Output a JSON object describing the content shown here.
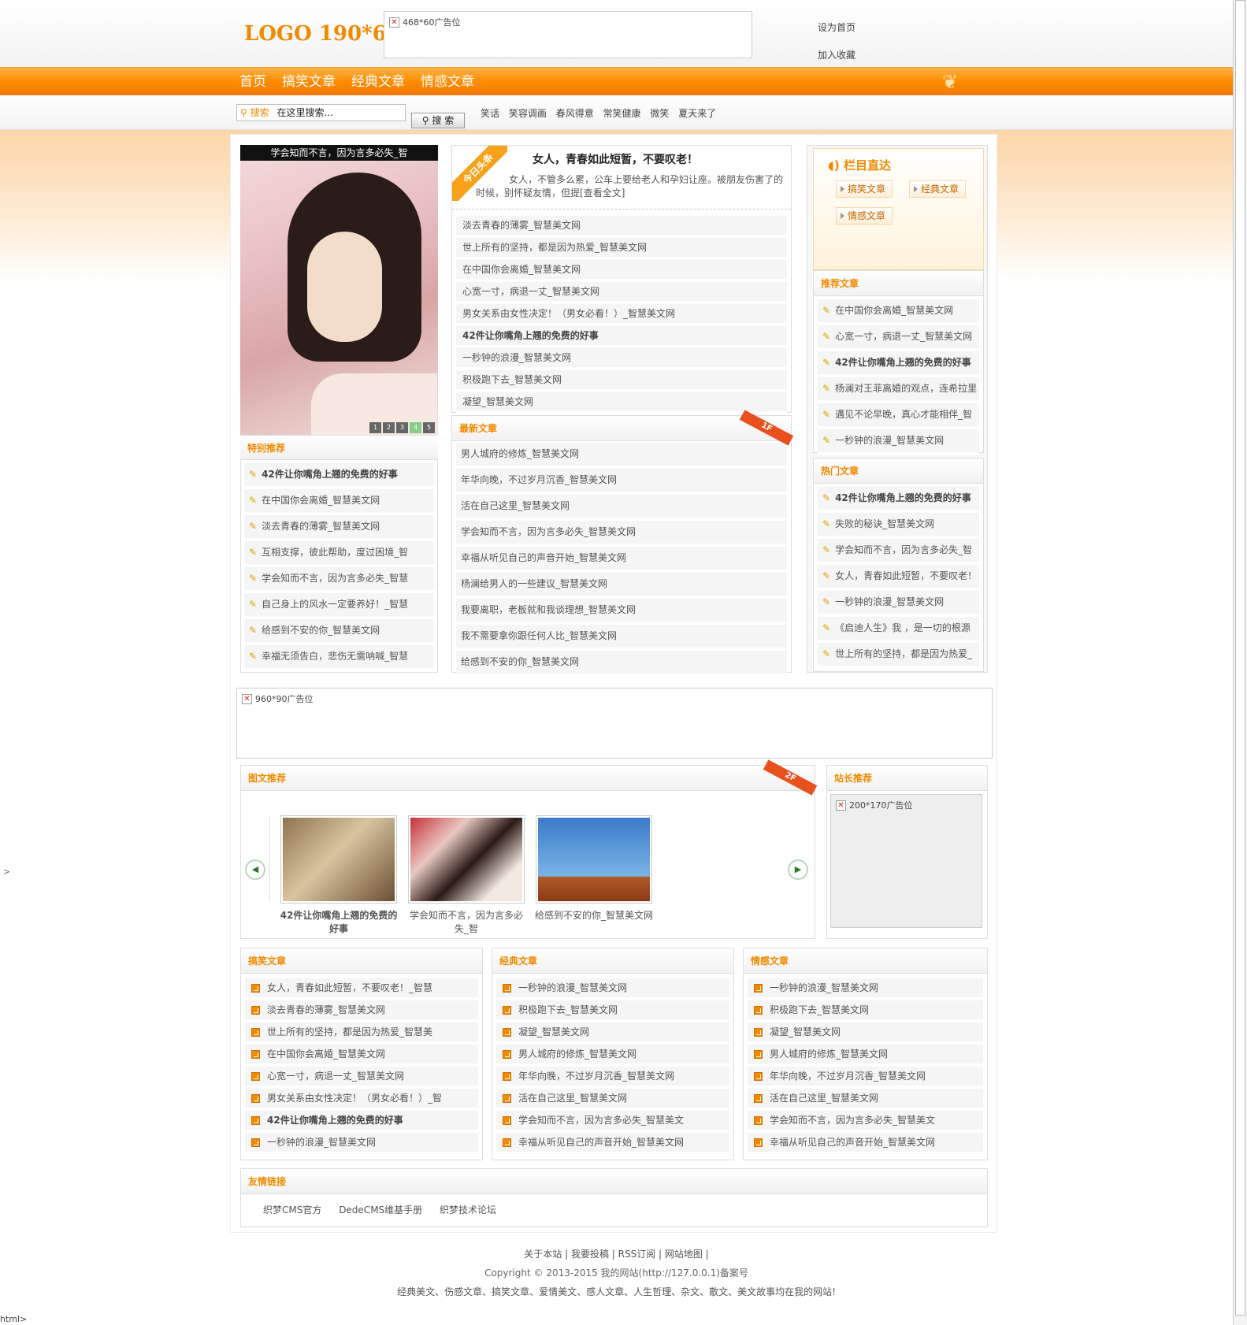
{
  "header": {
    "logo": "LOGO 190*60",
    "ad_top": "468*60广告位",
    "set_home": "设为首页",
    "add_fav": "加入收藏"
  },
  "nav": [
    "首页",
    "搞笑文章",
    "经典文章",
    "情感文章"
  ],
  "search": {
    "label": "搜索",
    "placeholder": "在这里搜索...",
    "button": "搜 索",
    "hotwords": [
      "笑话",
      "笑容调画",
      "春风得意",
      "常笑健康",
      "微笑",
      "夏天来了"
    ]
  },
  "focus": {
    "caption": "学会知而不言，因为言多必失_智",
    "pages": [
      "1",
      "2",
      "3",
      "4",
      "5"
    ],
    "active_page": 4
  },
  "special": {
    "title": "特别推荐",
    "items": [
      {
        "text": "42件让你嘴角上翘的免费的好事",
        "bold": true
      },
      {
        "text": "在中国你会离婚_智慧美文网"
      },
      {
        "text": "淡去青春的薄雾_智慧美文网"
      },
      {
        "text": "互相支撑，彼此帮助，度过困境_智"
      },
      {
        "text": "学会知而不言，因为言多必失_智慧"
      },
      {
        "text": "自己身上的风水一定要养好！_智慧"
      },
      {
        "text": "给感到不安的你_智慧美文网"
      },
      {
        "text": "幸福无须告白，悲伤无需呐喊_智慧"
      }
    ]
  },
  "headline": {
    "badge": "今日头条",
    "title": "女人，青春如此短暂，不要叹老！",
    "desc": "女人，不管多么累，公车上要给老人和孕妇让座。被朋友伤害了的时候，别怀疑友情，但提",
    "more": "[查看全文]"
  },
  "center_list": [
    {
      "text": "淡去青春的薄雾_智慧美文网"
    },
    {
      "text": "世上所有的坚持，都是因为热爱_智慧美文网"
    },
    {
      "text": "在中国你会离婚_智慧美文网"
    },
    {
      "text": "心宽一寸，病退一丈_智慧美文网"
    },
    {
      "text": "男女关系由女性决定！（男女必看！）_智慧美文网"
    },
    {
      "text": "42件让你嘴角上翘的免费的好事",
      "bold": true
    },
    {
      "text": "一秒钟的浪漫_智慧美文网"
    },
    {
      "text": "积极跑下去_智慧美文网"
    },
    {
      "text": "凝望_智慧美文网"
    }
  ],
  "latest": {
    "title": "最新文章",
    "floor": "1F",
    "items": [
      {
        "text": "男人城府的修炼_智慧美文网"
      },
      {
        "text": "年华向晚，不过岁月沉香_智慧美文网"
      },
      {
        "text": "活在自己这里_智慧美文网"
      },
      {
        "text": "学会知而不言，因为言多必失_智慧美文网"
      },
      {
        "text": "幸福从听见自己的声音开始_智慧美文网"
      },
      {
        "text": "杨澜给男人的一些建议_智慧美文网"
      },
      {
        "text": "我要离职，老板就和我谈理想_智慧美文网"
      },
      {
        "text": "我不需要拿你跟任何人比_智慧美文网"
      },
      {
        "text": "给感到不安的你_智慧美文网"
      }
    ]
  },
  "topics": {
    "title": "栏目直达",
    "items": [
      "搞笑文章",
      "经典文章",
      "情感文章"
    ]
  },
  "recommend": {
    "title": "推荐文章",
    "items": [
      {
        "text": "在中国你会离婚_智慧美文网"
      },
      {
        "text": "心宽一寸，病退一丈_智慧美文网"
      },
      {
        "text": "42件让你嘴角上翘的免费的好事",
        "bold": true
      },
      {
        "text": "杨澜对王菲离婚的观点，连希拉里"
      },
      {
        "text": "遇见不论早晚，真心才能相伴_智"
      },
      {
        "text": "一秒钟的浪漫_智慧美文网"
      }
    ]
  },
  "hot": {
    "title": "热门文章",
    "items": [
      {
        "text": "42件让你嘴角上翘的免费的好事",
        "bold": true
      },
      {
        "text": "失败的秘诀_智慧美文网"
      },
      {
        "text": "学会知而不言，因为言多必失_智"
      },
      {
        "text": "女人，青春如此短暂，不要叹老！"
      },
      {
        "text": "一秒钟的浪漫_智慧美文网"
      },
      {
        "text": "《启迪人生》我 ，是一切的根源"
      },
      {
        "text": "世上所有的坚持，都是因为热爱_"
      }
    ]
  },
  "ad_middle": "960*90广告位",
  "gallery": {
    "title": "图文推荐",
    "floor": "2F",
    "items": [
      {
        "caption": "42件让你嘴角上翘的免费的好事",
        "bold": true
      },
      {
        "caption": "学会知而不言，因为言多必失_智"
      },
      {
        "caption": "给感到不安的你_智慧美文网"
      }
    ]
  },
  "webmaster": {
    "title": "站长推荐",
    "ad": "200*170广告位"
  },
  "cols": [
    {
      "title": "搞笑文章",
      "items": [
        {
          "text": "女人，青春如此短暂，不要叹老！_智慧"
        },
        {
          "text": "淡去青春的薄雾_智慧美文网"
        },
        {
          "text": "世上所有的坚持，都是因为热爱_智慧美"
        },
        {
          "text": "在中国你会离婚_智慧美文网"
        },
        {
          "text": "心宽一寸，病退一丈_智慧美文网"
        },
        {
          "text": "男女关系由女性决定！（男女必看！）_智"
        },
        {
          "text": "42件让你嘴角上翘的免费的好事",
          "bold": true
        },
        {
          "text": "一秒钟的浪漫_智慧美文网"
        }
      ]
    },
    {
      "title": "经典文章",
      "items": [
        {
          "text": "一秒钟的浪漫_智慧美文网"
        },
        {
          "text": "积极跑下去_智慧美文网"
        },
        {
          "text": "凝望_智慧美文网"
        },
        {
          "text": "男人城府的修炼_智慧美文网"
        },
        {
          "text": "年华向晚，不过岁月沉香_智慧美文网"
        },
        {
          "text": "活在自己这里_智慧美文网"
        },
        {
          "text": "学会知而不言，因为言多必失_智慧美文"
        },
        {
          "text": "幸福从听见自己的声音开始_智慧美文网"
        }
      ]
    },
    {
      "title": "情感文章",
      "items": [
        {
          "text": "一秒钟的浪漫_智慧美文网"
        },
        {
          "text": "积极跑下去_智慧美文网"
        },
        {
          "text": "凝望_智慧美文网"
        },
        {
          "text": "男人城府的修炼_智慧美文网"
        },
        {
          "text": "年华向晚，不过岁月沉香_智慧美文网"
        },
        {
          "text": "活在自己这里_智慧美文网"
        },
        {
          "text": "学会知而不言，因为言多必失_智慧美文"
        },
        {
          "text": "幸福从听见自己的声音开始_智慧美文网"
        }
      ]
    }
  ],
  "links": {
    "title": "友情链接",
    "items": [
      "织梦CMS官方",
      "DedeCMS维基手册",
      "织梦技术论坛"
    ]
  },
  "footer": {
    "links": "关于本站 | 我要投稿 | RSS订阅 | 网站地图 |",
    "copyright": "Copyright © 2013-2015 我的网站(http://127.0.0.1)备案号",
    "desc": "经典美文、伤感文章、搞笑文章、爱情美文、感人文章、人生哲理、杂文、散文、美文故事均在我的网站!"
  },
  "misc": {
    "gt": ">",
    "html_tag": "html>"
  }
}
